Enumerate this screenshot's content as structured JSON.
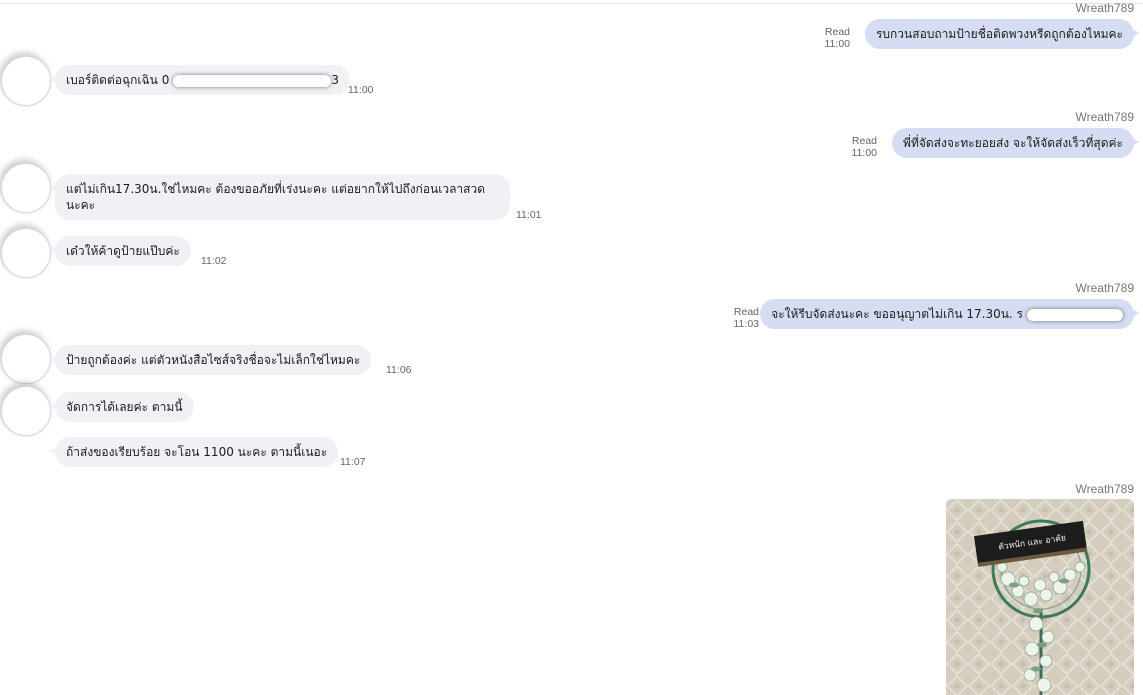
{
  "chat": {
    "messages": [
      {
        "direction": "out",
        "sender": "Wreath789",
        "status": "Read",
        "time": "11:00",
        "text": "รบกวนสอบถามป้ายชื่อติดพวงหรีดถูกต้องไหมคะ"
      },
      {
        "direction": "in",
        "time": "11:00",
        "text": "เบอร์ติดต่อฉุกเฉิน 0",
        "text_tail": "3"
      },
      {
        "direction": "out",
        "sender": "Wreath789",
        "status": "Read",
        "time": "11:00",
        "text": "พี่ที่จัดส่งจะทะยอยส่ง จะให้จัดส่งเร็วที่สุดค่ะ"
      },
      {
        "direction": "in",
        "time": "11:01",
        "text": "แต่ไม่เกิน17.30น.ใช่ไหมคะ ต้องขออภัยที่เร่งนะคะ แต่อยากให้ไปถึงก่อนเวลาสวด นะคะ"
      },
      {
        "direction": "in",
        "time": "11:02",
        "text": "เด๋วให้ค้าดูป้ายแป๊บค่ะ"
      },
      {
        "direction": "out",
        "sender": "Wreath789",
        "status": "Read",
        "time": "11:03",
        "text": "จะให้รีบจัดส่งนะคะ ขออนุญาตไม่เกิน 17.30น. ร"
      },
      {
        "direction": "in",
        "time": "11:06",
        "text": "ป้ายถูกต้องค่ะ แต่ตัวหนังสือไซส์จริงชื่อจะไม่เล็กใช่ไหมคะ"
      },
      {
        "direction": "in",
        "time": "",
        "text": "จัดการได้เลยค่ะ ตามนี้"
      },
      {
        "direction": "in",
        "time": "11:07",
        "text": "ถ้าส่งของเรียบร้อย จะโอน 1100 นะคะ ตามนี้เนอะ"
      },
      {
        "direction": "out",
        "sender": "Wreath789",
        "type": "image",
        "image": "wreath-photo",
        "image_text": "ตัวหนัก และ อาคัย"
      }
    ]
  },
  "colors": {
    "outgoing_bubble": "#d6ddf3",
    "incoming_bubble": "#f0f1f4",
    "meta_text": "#666666"
  }
}
